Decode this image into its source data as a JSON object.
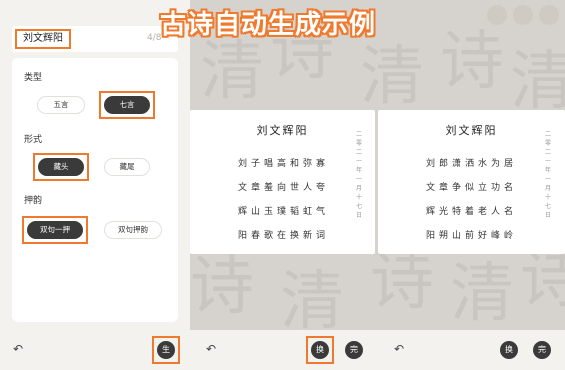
{
  "banner": "古诗自动生成示例",
  "left_panel": {
    "title": "刘文辉阳",
    "counter": "4/8",
    "sections": {
      "type": {
        "label": "类型",
        "options": [
          "五言",
          "七言"
        ],
        "selected": "七言"
      },
      "form": {
        "label": "形式",
        "options": [
          "藏头",
          "藏尾"
        ],
        "selected": "藏头"
      },
      "rhyme": {
        "label": "押韵",
        "options": [
          "双句一押",
          "双句押韵"
        ],
        "selected": "双句一押"
      }
    },
    "generate_label": "生"
  },
  "poems": [
    {
      "title": "刘文辉阳",
      "lines": [
        "刘子唱高和弥寡",
        "文章羞向世人夸",
        "辉山玉璞韬虹气",
        "阳春歌在换新词"
      ],
      "date": "二零二一年 一月 十七日"
    },
    {
      "title": "刘文辉阳",
      "lines": [
        "刘郎潇洒水为居",
        "文章争似立功名",
        "辉光特着老人名",
        "阳朔山前好峰岭"
      ],
      "date": "二零二一年 一月 十七日"
    }
  ],
  "actions": {
    "swap": "换",
    "done": "完"
  },
  "icons": {
    "undo": "undo-icon"
  }
}
